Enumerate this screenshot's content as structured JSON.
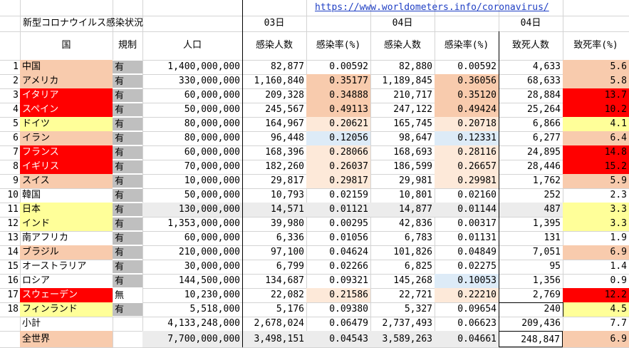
{
  "title": "新型コロナウイルス感染状況",
  "link": "https://www.worldometers.info/coronavirus/",
  "day_labels": {
    "col_d": "03日",
    "col_f": "04日",
    "col_h": "04日"
  },
  "headers": {
    "country": "国",
    "regulation": "規制",
    "population": "人口",
    "infected_03": "感染人数",
    "rate_03": "感染率(%)",
    "infected_04": "感染人数",
    "rate_04": "感染率(%)",
    "deaths": "致死人数",
    "fatality": "致死率(%)"
  },
  "colors": {
    "red": "#ff0000",
    "orange": "#f8cbad",
    "yellow": "#ffff99",
    "gray": "#bfbfbf",
    "light_gray": "#ececec",
    "light_peach": "#fde9d9",
    "light_blue": "#ddebf7",
    "grid_line": "#d4d4d4"
  },
  "rows": [
    {
      "no": "1",
      "country": "中国",
      "reg": "有",
      "pop": "1,400,000,000",
      "inf03": "82,877",
      "rate03": "0.00592",
      "inf04": "82,880",
      "rate04": "0.00592",
      "deaths": "4,633",
      "fat": "5.6"
    },
    {
      "no": "2",
      "country": "アメリカ",
      "reg": "有",
      "pop": "330,000,000",
      "inf03": "1,160,840",
      "rate03": "0.35177",
      "inf04": "1,189,845",
      "rate04": "0.36056",
      "deaths": "68,633",
      "fat": "5.8"
    },
    {
      "no": "3",
      "country": "イタリア",
      "reg": "有",
      "pop": "60,000,000",
      "inf03": "209,328",
      "rate03": "0.34888",
      "inf04": "210,717",
      "rate04": "0.35120",
      "deaths": "28,884",
      "fat": "13.7"
    },
    {
      "no": "4",
      "country": "スペイン",
      "reg": "有",
      "pop": "50,000,000",
      "inf03": "245,567",
      "rate03": "0.49113",
      "inf04": "247,122",
      "rate04": "0.49424",
      "deaths": "25,264",
      "fat": "10.2"
    },
    {
      "no": "5",
      "country": "ドイツ",
      "reg": "有",
      "pop": "80,000,000",
      "inf03": "164,967",
      "rate03": "0.20621",
      "inf04": "165,745",
      "rate04": "0.20718",
      "deaths": "6,866",
      "fat": "4.1"
    },
    {
      "no": "6",
      "country": "イラン",
      "reg": "有",
      "pop": "80,000,000",
      "inf03": "96,448",
      "rate03": "0.12056",
      "inf04": "98,647",
      "rate04": "0.12331",
      "deaths": "6,277",
      "fat": "6.4"
    },
    {
      "no": "7",
      "country": "フランス",
      "reg": "有",
      "pop": "60,000,000",
      "inf03": "168,396",
      "rate03": "0.28066",
      "inf04": "168,693",
      "rate04": "0.28116",
      "deaths": "24,895",
      "fat": "14.8"
    },
    {
      "no": "8",
      "country": "イギリス",
      "reg": "有",
      "pop": "70,000,000",
      "inf03": "182,260",
      "rate03": "0.26037",
      "inf04": "186,599",
      "rate04": "0.26657",
      "deaths": "28,446",
      "fat": "15.2"
    },
    {
      "no": "9",
      "country": "スイス",
      "reg": "有",
      "pop": "10,000,000",
      "inf03": "29,817",
      "rate03": "0.29817",
      "inf04": "29,981",
      "rate04": "0.29981",
      "deaths": "1,762",
      "fat": "5.9"
    },
    {
      "no": "10",
      "country": "韓国",
      "reg": "有",
      "pop": "50,000,000",
      "inf03": "10,793",
      "rate03": "0.02159",
      "inf04": "10,801",
      "rate04": "0.02160",
      "deaths": "252",
      "fat": "2.3"
    },
    {
      "no": "11",
      "country": "日本",
      "reg": "有",
      "pop": "130,000,000",
      "inf03": "14,571",
      "rate03": "0.01121",
      "inf04": "14,877",
      "rate04": "0.01144",
      "deaths": "487",
      "fat": "3.3"
    },
    {
      "no": "12",
      "country": "インド",
      "reg": "有",
      "pop": "1,353,000,000",
      "inf03": "39,980",
      "rate03": "0.00295",
      "inf04": "42,836",
      "rate04": "0.00317",
      "deaths": "1,395",
      "fat": "3.3"
    },
    {
      "no": "13",
      "country": "南アフリカ",
      "reg": "有",
      "pop": "60,000,000",
      "inf03": "6,336",
      "rate03": "0.01056",
      "inf04": "6,783",
      "rate04": "0.01131",
      "deaths": "131",
      "fat": "1.9"
    },
    {
      "no": "14",
      "country": "ブラジル",
      "reg": "有",
      "pop": "210,000,000",
      "inf03": "97,100",
      "rate03": "0.04624",
      "inf04": "101,826",
      "rate04": "0.04849",
      "deaths": "7,051",
      "fat": "6.9"
    },
    {
      "no": "15",
      "country": "オーストラリア",
      "reg": "有",
      "pop": "30,000,000",
      "inf03": "6,799",
      "rate03": "0.02266",
      "inf04": "6,825",
      "rate04": "0.02275",
      "deaths": "95",
      "fat": "1.4"
    },
    {
      "no": "16",
      "country": "ロシア",
      "reg": "有",
      "pop": "144,500,000",
      "inf03": "134,687",
      "rate03": "0.09321",
      "inf04": "145,268",
      "rate04": "0.10053",
      "deaths": "1,356",
      "fat": "0.9"
    },
    {
      "no": "17",
      "country": "スウェーデン",
      "reg": "無",
      "pop": "10,230,000",
      "inf03": "22,082",
      "rate03": "0.21586",
      "inf04": "22,721",
      "rate04": "0.22210",
      "deaths": "2,769",
      "fat": "12.2"
    },
    {
      "no": "18",
      "country": "フィンランド",
      "reg": "有",
      "pop": "5,518,000",
      "inf03": "5,176",
      "rate03": "0.09380",
      "inf04": "5,327",
      "rate04": "0.09654",
      "deaths": "240",
      "fat": "4.5"
    }
  ],
  "subtotal": {
    "label": "小計",
    "pop": "4,133,248,000",
    "inf03": "2,678,024",
    "rate03": "0.06479",
    "inf04": "2,737,493",
    "rate04": "0.06623",
    "deaths": "209,436",
    "fat": "7.7"
  },
  "world": {
    "label": "全世界",
    "pop": "7,700,000,000",
    "inf03": "3,498,151",
    "rate03": "0.04543",
    "inf04": "3,589,263",
    "rate04": "0.04661",
    "deaths": "248,847",
    "fat": "6.9"
  }
}
